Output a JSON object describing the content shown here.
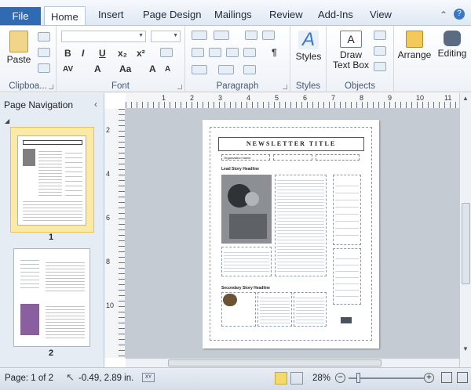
{
  "tabs": {
    "file": "File",
    "home": "Home",
    "insert": "Insert",
    "page_design": "Page Design",
    "mailings": "Mailings",
    "review": "Review",
    "addins": "Add-Ins",
    "view": "View"
  },
  "groups": {
    "clipboard": "Clipboa...",
    "font": "Font",
    "paragraph": "Paragraph",
    "styles": "Styles",
    "objects": "Objects"
  },
  "buttons": {
    "paste": "Paste",
    "styles": "Styles",
    "draw_text_box_1": "Draw",
    "draw_text_box_2": "Text Box",
    "arrange": "Arrange",
    "editing": "Editing"
  },
  "nav": {
    "title": "Page Navigation",
    "pages": [
      {
        "number": "1"
      },
      {
        "number": "2"
      }
    ]
  },
  "newsletter": {
    "title": "NEWSLETTER TITLE",
    "org": "Organization Name",
    "lead": "Lead Story Headline",
    "secondary": "Secondary Story Headline"
  },
  "status": {
    "page": "Page: 1 of 2",
    "position": "-0.49, 2.89 in.",
    "zoom": "28%"
  },
  "ruler": {
    "h": [
      "1",
      "2",
      "3",
      "4",
      "5",
      "6",
      "7",
      "8",
      "9",
      "10",
      "11"
    ],
    "v": [
      "2",
      "4",
      "6",
      "8",
      "10"
    ]
  },
  "colors": {
    "accent": "#2f6ab3",
    "workspace": "#c5cbd3",
    "selection": "#fbe9a6"
  }
}
